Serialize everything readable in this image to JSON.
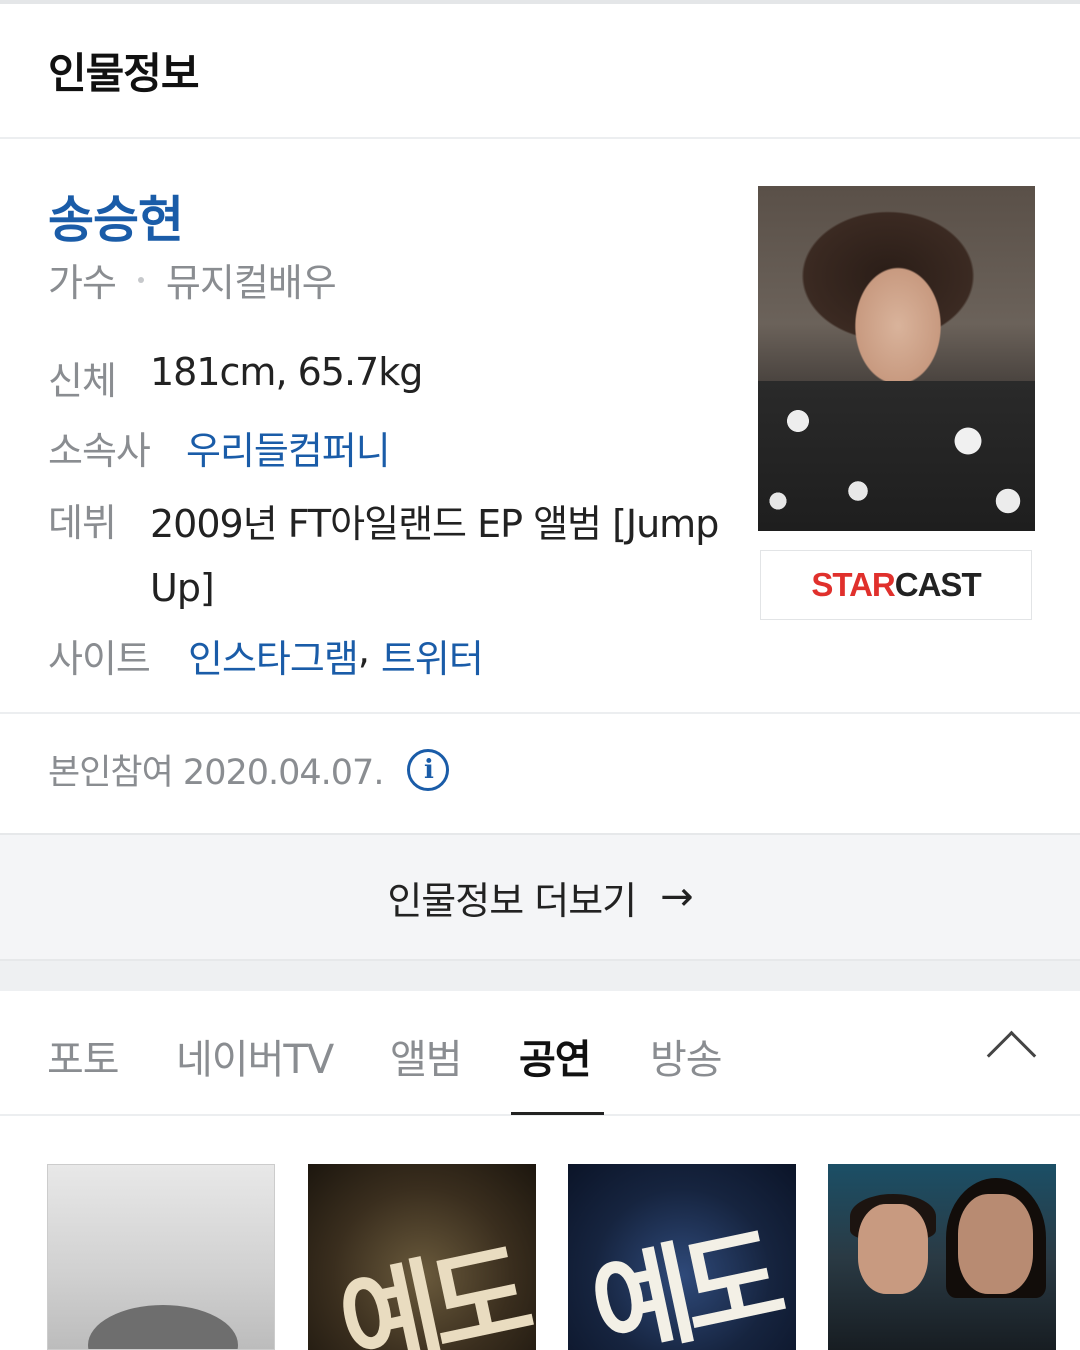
{
  "section": {
    "title": "인물정보"
  },
  "profile": {
    "name": "송승현",
    "jobs": [
      "가수",
      "뮤지컬배우"
    ],
    "body_label": "신체",
    "body_value": "181cm, 65.7kg",
    "agency_label": "소속사",
    "agency_value": "우리들컴퍼니",
    "debut_label": "데뷔",
    "debut_value": "2009년 FT아일랜드 EP 앨범 [Jump Up]",
    "site_label": "사이트",
    "site_instagram": "인스타그램",
    "site_sep": ",",
    "site_twitter": "트위터",
    "photo_credit": {
      "star": "STAR",
      "cast": "CAST"
    }
  },
  "participation": {
    "text": "본인참여 2020.04.07.",
    "info_icon": "info-icon"
  },
  "more": {
    "label": "인물정보 더보기",
    "arrow": "→"
  },
  "tabs": [
    {
      "label": "포토",
      "active": false
    },
    {
      "label": "네이버TV",
      "active": false
    },
    {
      "label": "앨범",
      "active": false
    },
    {
      "label": "공연",
      "active": true
    },
    {
      "label": "방송",
      "active": false
    }
  ],
  "collapse_icon": "chevron-up-icon",
  "posters": {
    "p2_title": "예도",
    "p3_title": "예도"
  },
  "colors": {
    "link": "#1a5ca8",
    "muted": "#8a8d91",
    "starcast_red": "#e0302c"
  }
}
